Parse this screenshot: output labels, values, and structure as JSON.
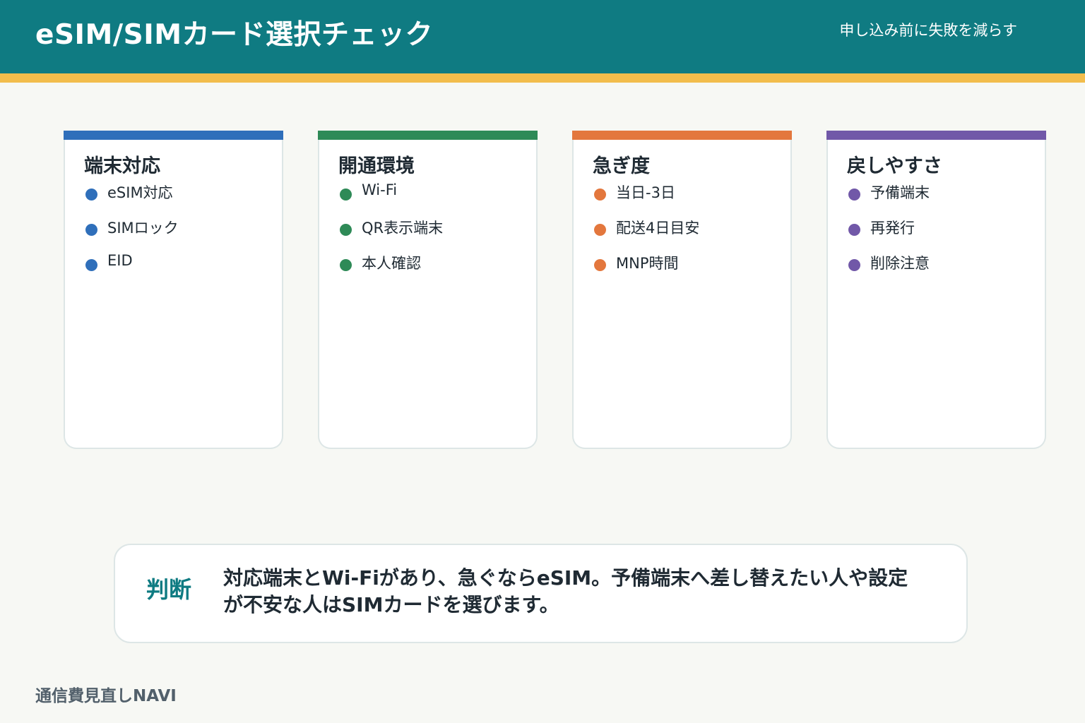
{
  "header": {
    "title": "eSIM/SIMカード選択チェック",
    "subtitle": "申し込み前に失敗を減らす"
  },
  "colors": {
    "primary": "#0f7b82",
    "accent_stripe": "#f2bd4c",
    "blue": "#2f6fba",
    "green": "#2e8a57",
    "orange": "#e3773d",
    "purple": "#7158a8"
  },
  "cards": [
    {
      "title": "端末対応",
      "color": "#2f6fba",
      "items": [
        "eSIM対応",
        "SIMロック",
        "EID"
      ]
    },
    {
      "title": "開通環境",
      "color": "#2e8a57",
      "items": [
        "Wi-Fi",
        "QR表示端末",
        "本人確認"
      ]
    },
    {
      "title": "急ぎ度",
      "color": "#e3773d",
      "items": [
        "当日-3日",
        "配送4日目安",
        "MNP時間"
      ]
    },
    {
      "title": "戻しやすさ",
      "color": "#7158a8",
      "items": [
        "予備端末",
        "再発行",
        "削除注意"
      ]
    }
  ],
  "judgement": {
    "label": "判断",
    "text": "対応端末とWi-Fiがあり、急ぐならeSIM。予備端末へ差し替えたい人や設定が不安な人はSIMカードを選びます。"
  },
  "footer": {
    "brand": "通信費見直しNAVI"
  }
}
